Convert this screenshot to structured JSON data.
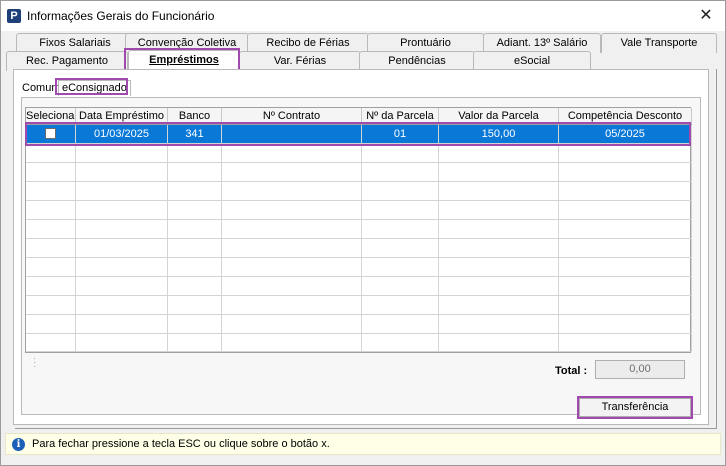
{
  "window": {
    "title": "Informações Gerais do Funcionário",
    "close_symbol": "✕",
    "icon_letter": "P"
  },
  "tabs_row1": [
    "Fixos Salariais",
    "Convenção Coletiva",
    "Recibo de Férias",
    "Prontuário",
    "Adiant. 13º Salário",
    "Vale Transporte"
  ],
  "tabs_row2": [
    "Rec. Pagamento",
    "Empréstimos",
    "Var. Férias",
    "Pendências",
    "eSocial"
  ],
  "active_tab": "Empréstimos",
  "subtabs": [
    "Comum",
    "eConsignado"
  ],
  "active_subtab": "eConsignado",
  "grid": {
    "columns": [
      "Selecionar",
      "Data Empréstimo",
      "Banco",
      "Nº Contrato",
      "Nº da Parcela",
      "Valor da Parcela",
      "Competência Desconto"
    ],
    "rows": [
      {
        "selecionar": false,
        "data": "01/03/2025",
        "banco": "341",
        "contrato": "",
        "parcela": "01",
        "valor": "150,00",
        "competencia": "05/2025"
      }
    ]
  },
  "total": {
    "label": "Total :",
    "value": "0,00"
  },
  "buttons": {
    "transfer": "Transferência"
  },
  "status": {
    "icon": "i",
    "text": "Para fechar pressione a tecla ESC ou clique sobre o botão x."
  },
  "colors": {
    "selection": "#0a78d7",
    "highlight": "#a04ab0",
    "status_bg": "#ffffe8"
  }
}
